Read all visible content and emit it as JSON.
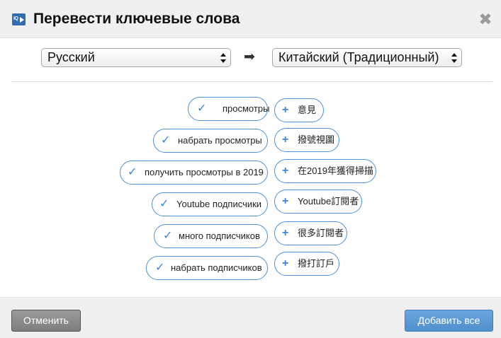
{
  "dialog": {
    "title": "Перевести ключевые слова",
    "logo_text": "IQ",
    "close_glyph": "✖"
  },
  "languages": {
    "from": "Русский",
    "to": "Китайский (Традиционный)",
    "arrow_glyph": "➡"
  },
  "keywords": [
    {
      "original": "просмотры",
      "translation": "意見"
    },
    {
      "original": "набрать просмотры",
      "translation": "撥號視圖"
    },
    {
      "original": "получить просмотры в 2019",
      "translation": "在2019年獲得掃描"
    },
    {
      "original": "Youtube подписчики",
      "translation": "Youtube訂閱者"
    },
    {
      "original": "много подписчиков",
      "translation": "很多訂閱者"
    },
    {
      "original": "набрать подписчиков",
      "translation": "撥打訂戶"
    }
  ],
  "icons": {
    "check": "✓",
    "plus": "+"
  },
  "footer": {
    "cancel_label": "Отменить",
    "add_all_label": "Добавить все"
  },
  "colors": {
    "accent": "#4a90d9",
    "primary_button": "#5b9ad6",
    "secondary_button": "#8a8a8a",
    "header_bg": "#f0f0f0"
  }
}
